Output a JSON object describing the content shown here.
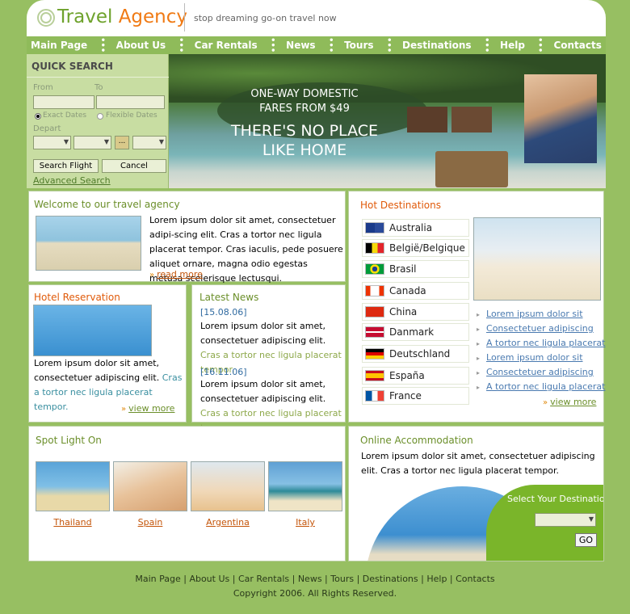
{
  "header": {
    "logo_travel": "Travel",
    "logo_agency": "Agency",
    "tagline": "stop dreaming go-on travel now"
  },
  "nav": [
    "Main Page",
    "About Us",
    "Car Rentals",
    "News",
    "Tours",
    "Destinations",
    "Help",
    "Contacts"
  ],
  "quick_search": {
    "title": "QUICK SEARCH",
    "from": "From",
    "to": "To",
    "exact": "Exact Dates",
    "flexible": "Flexible Dates",
    "depart": "Depart",
    "search_btn": "Search Flight",
    "cancel_btn": "Cancel",
    "advanced": "Advanced Search",
    "date_btn": "..."
  },
  "banner": {
    "line1": "ONE-WAY DOMESTIC",
    "line2": "FARES FROM $49",
    "line3": "THERE'S NO PLACE",
    "line4": "LIKE HOME"
  },
  "welcome": {
    "title": "Welcome to our travel agency",
    "text": "Lorem ipsum dolor sit amet, consectetuer adipi-scing elit. Cras a tortor nec ligula placerat tempor. Cras iaculis, pede posuere aliquet ornare, magna odio egestas metusa scelerisque lectusqui.",
    "more": "read more"
  },
  "hotel": {
    "title": "Hotel Reservation",
    "text": "Lorem ipsum dolor sit amet, consectetuer adipiscing elit.",
    "text_green": "Cras a tortor nec ligula placerat tempor.",
    "more": "view more"
  },
  "news": {
    "title": "Latest News",
    "items": [
      {
        "date": "[15.08.06]",
        "text": "Lorem ipsum dolor sit amet, consectetuer adipiscing elit.",
        "green": "Cras a tortor nec ligula placerat tempor."
      },
      {
        "date": "[16.11.06]",
        "text": "Lorem ipsum dolor sit amet, consectetuer adipiscing elit.",
        "green": "Cras a tortor nec ligula placerat tempor."
      }
    ]
  },
  "hot": {
    "title": "Hot Destinations",
    "countries": [
      "Australia",
      "België/Belgique",
      "Brasil",
      "Canada",
      "China",
      "Danmark",
      "Deutschland",
      "España",
      "France"
    ],
    "links": [
      "Lorem ipsum dolor sit",
      "Consectetuer adipiscing",
      "A tortor nec ligula placerat",
      "Lorem ipsum dolor sit",
      "Consectetuer adipiscing",
      "A tortor nec ligula placerat"
    ],
    "more": "view more"
  },
  "spotlight": {
    "title": "Spot Light On",
    "items": [
      "Thailand",
      "Spain",
      "Argentina",
      "Italy"
    ]
  },
  "online": {
    "title": "Online Accommodation",
    "text": "Lorem ipsum dolor sit amet, consectetuer adipiscing elit. Cras a tortor nec ligula placerat tempor.",
    "select_label": "Select Your Destination",
    "go": "GO"
  },
  "footer": {
    "links": [
      "Main Page",
      "About Us",
      "Car Rentals",
      "News",
      "Tours",
      "Destinations",
      "Help",
      "Contacts"
    ],
    "copyright": "Copyright 2006. All Rights Reserved."
  },
  "colors": {
    "bg": "#97bf62",
    "nav": "#8fbb5a",
    "accent_green": "#6ea22c",
    "accent_orange": "#f07a14"
  }
}
